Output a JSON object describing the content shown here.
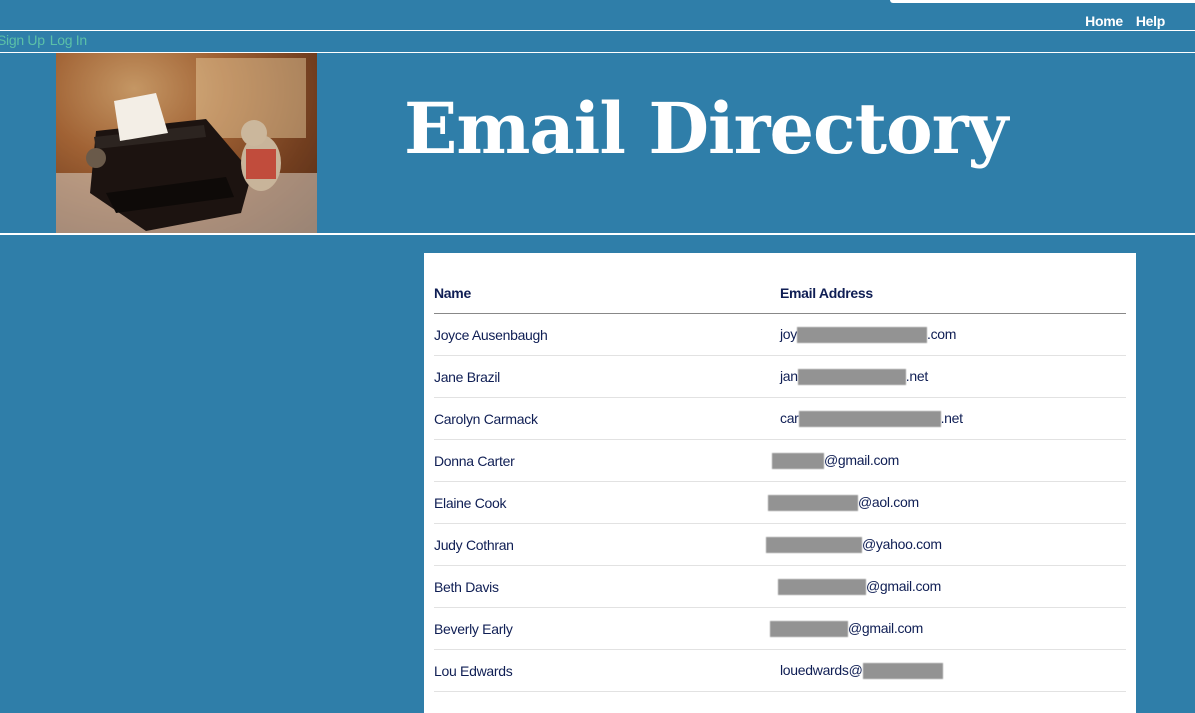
{
  "nav": {
    "home": "Home",
    "help": "Help"
  },
  "auth": {
    "signup": "Sign Up",
    "login": "Log In"
  },
  "header": {
    "title": "Email Directory"
  },
  "table": {
    "columns": [
      "Name",
      "Email Address"
    ],
    "rows": [
      {
        "name": "Joyce Ausenbaugh",
        "email_prefix": "joy",
        "email_suffix": ".com"
      },
      {
        "name": "Jane Brazil",
        "email_prefix": "jan",
        "email_suffix": ".net"
      },
      {
        "name": "Carolyn Carmack",
        "email_prefix": "car",
        "email_suffix": ".net"
      },
      {
        "name": "Donna Carter",
        "email_prefix": "",
        "email_suffix": "@gmail.com"
      },
      {
        "name": "Elaine Cook",
        "email_prefix": "",
        "email_suffix": "@aol.com"
      },
      {
        "name": "Judy Cothran",
        "email_prefix": "",
        "email_suffix": "@yahoo.com"
      },
      {
        "name": "Beth Davis",
        "email_prefix": "",
        "email_suffix": "@gmail.com"
      },
      {
        "name": "Beverly Early",
        "email_prefix": "",
        "email_suffix": "@gmail.com"
      },
      {
        "name": "Lou Edwards",
        "email_prefix": "louedwards@",
        "email_suffix": ""
      }
    ]
  }
}
